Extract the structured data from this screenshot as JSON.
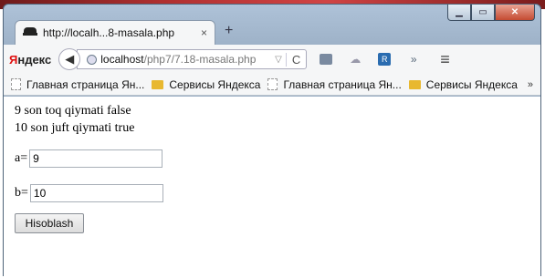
{
  "tab": {
    "title": "http://localh...8-masala.php",
    "close": "×",
    "new_tab": "+"
  },
  "nav": {
    "logo_prefix": "Я",
    "logo_rest": "ндекс",
    "url_host": "localhost",
    "url_path": "/php7/7.18-masala.php",
    "reload": "C",
    "more": "»",
    "menu": "≡"
  },
  "bookmarks": {
    "items": [
      {
        "label": "Главная страница Ян...",
        "icon": "page-icon"
      },
      {
        "label": "Сервисы Яндекса",
        "icon": "folder-icon"
      },
      {
        "label": "Главная страница Ян...",
        "icon": "page-icon"
      },
      {
        "label": "Сервисы Яндекса",
        "icon": "folder-icon"
      }
    ],
    "more": "»"
  },
  "content": {
    "line1": "9 son toq qiymati false",
    "line2": "10 son juft qiymati true",
    "a_label": "a=",
    "a_value": "9",
    "b_label": "b=",
    "b_value": "10",
    "submit_label": "Hisoblash"
  }
}
